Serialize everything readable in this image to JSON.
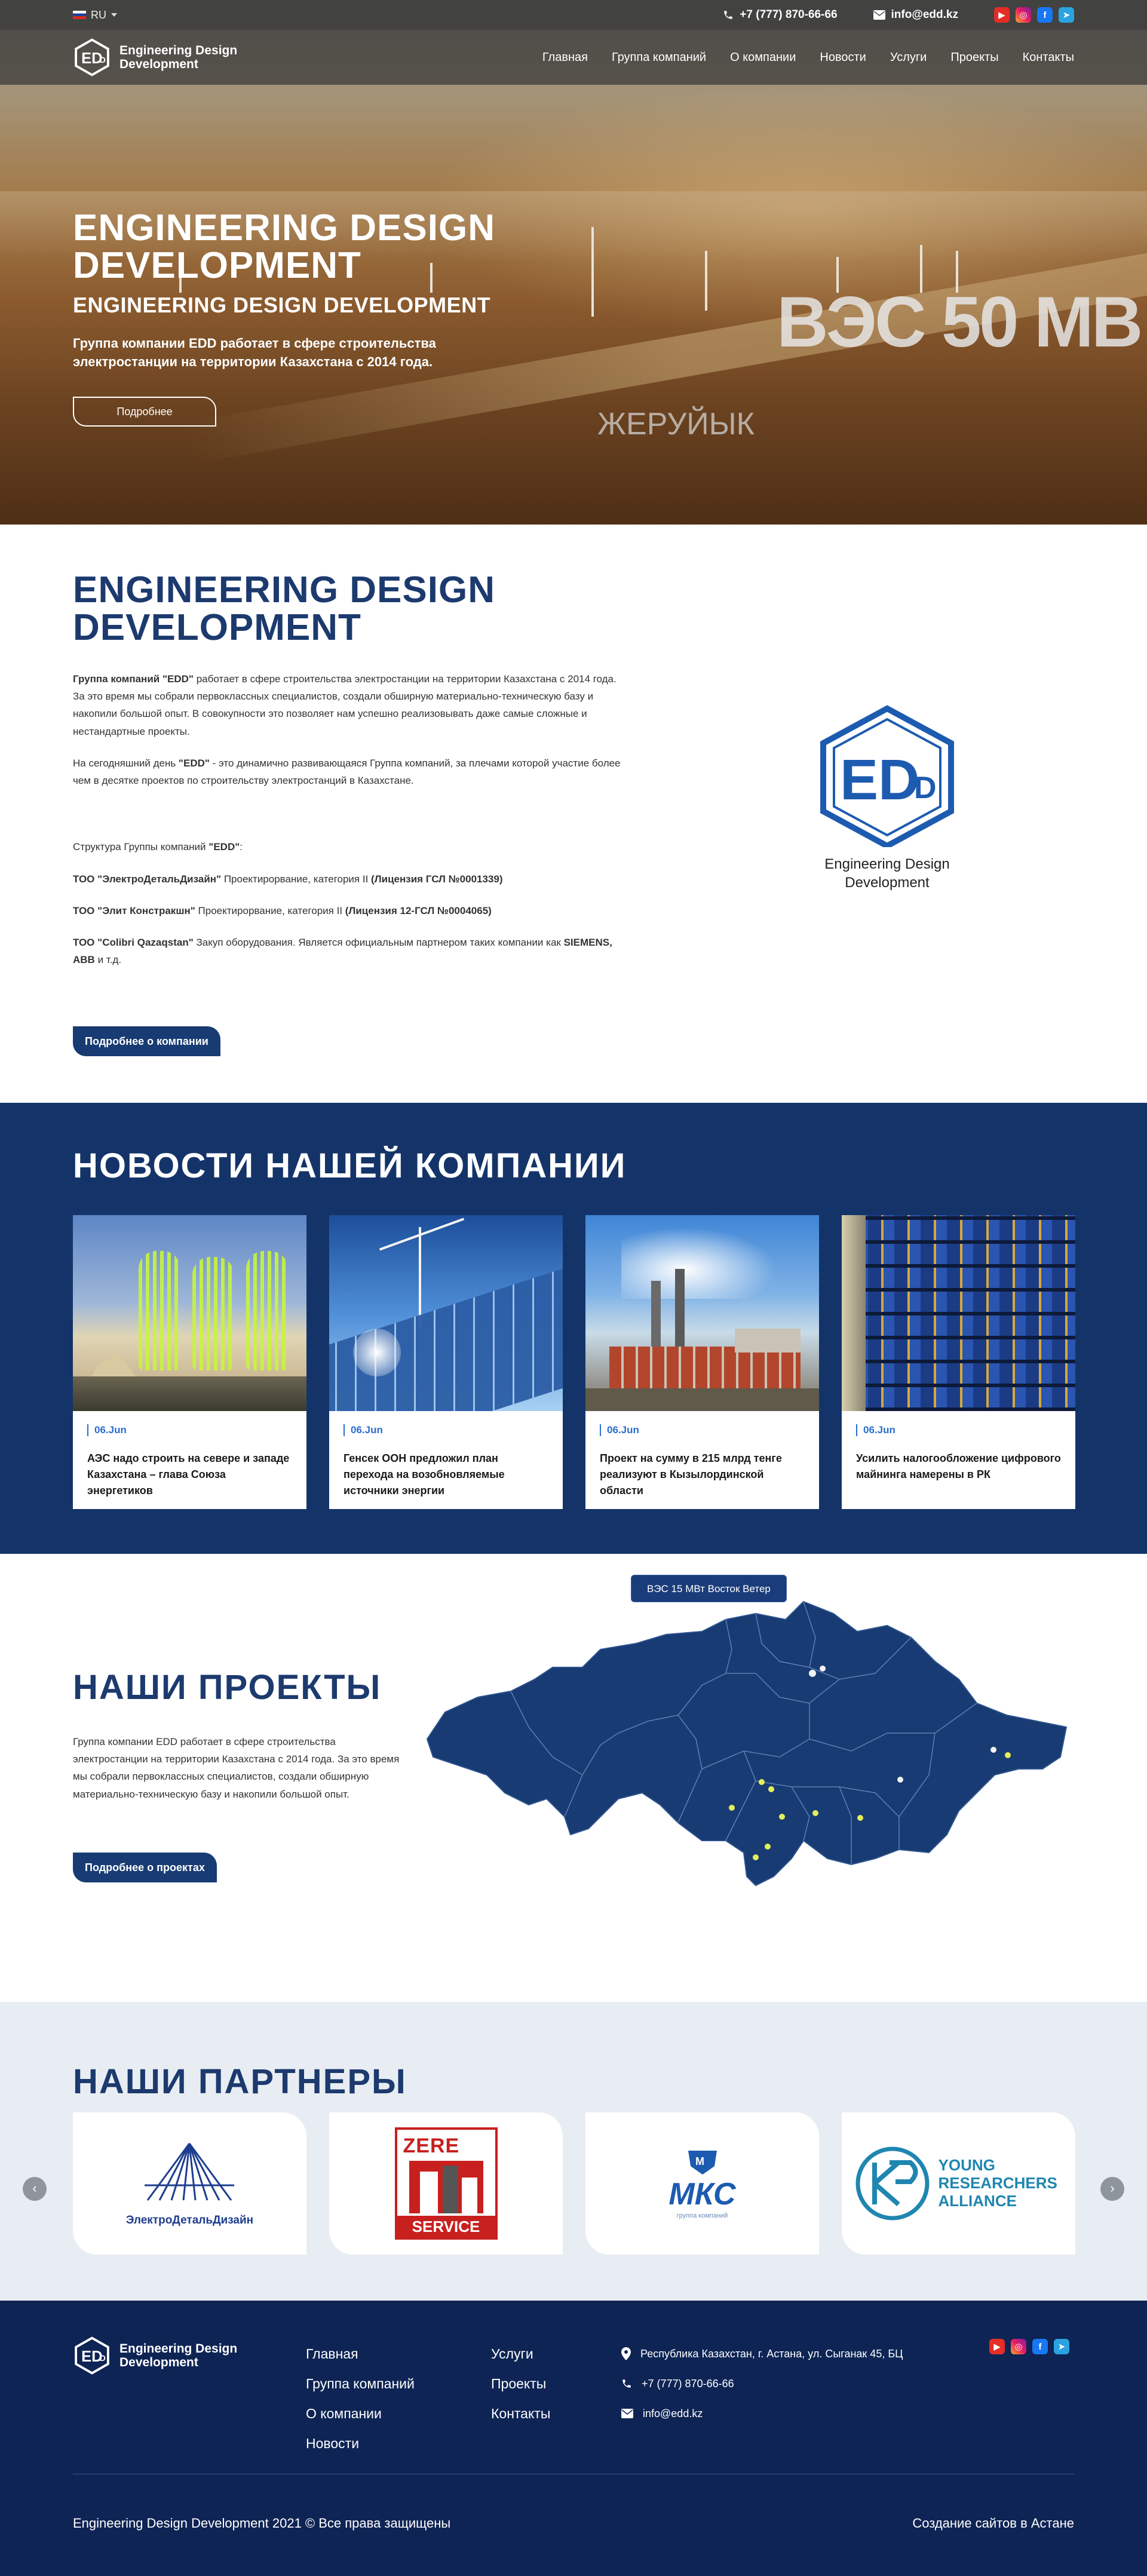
{
  "topbar": {
    "lang": "RU",
    "phone": "+7 (777) 870-66-66",
    "email": "info@edd.kz",
    "socials": [
      "youtube-icon",
      "instagram-icon",
      "facebook-icon",
      "telegram-icon"
    ]
  },
  "header": {
    "logo_line1": "Engineering Design",
    "logo_line2": "Development",
    "nav": [
      "Главная",
      "Группа компаний",
      "О компании",
      "Новости",
      "Услуги",
      "Проекты",
      "Контакты"
    ]
  },
  "hero": {
    "title": "ENGINEERING DESIGN DEVELOPMENT",
    "subtitle": "ENGINEERING DESIGN DEVELOPMENT",
    "text": "Группа компании EDD работает в сфере строительства электростанции на территории Казахстана с 2014 года.",
    "button": "Подробнее",
    "photo_overlay_big": "ВЭС 50 МВ",
    "photo_overlay_small": "ЖЕРУЙЫК"
  },
  "about": {
    "title": "ENGINEERING DESIGN DEVELOPMENT",
    "p1_bold": "Группа компаний \"EDD\"",
    "p1": " работает в сфере строительства электростанции на территории Казахстана с 2014 года. За это время мы собрали первоклассных специалистов, создали обширную материально-техническую базу и накопили большой опыт. В совокупности это позволяет нам успешно реализовывать даже самые сложные и нестандартные проекты.",
    "p2_a": "На сегодняшний день ",
    "p2_bold": "\"EDD\"",
    "p2_b": " - это динамично развивающаяся Группа компаний, за плечами которой участие более чем в десятке проектов по строительству электростанций в Казахстане.",
    "structure_a": "Структура Группы компаний ",
    "structure_bold": "\"EDD\"",
    "structure_b": ":",
    "c1_bold": "ТОО \"ЭлектроДетальДизайн\"",
    "c1": " Проектирорвание, категория II ",
    "c1_lic": "(Лицензия ГСЛ №0001339)",
    "c2_bold": "ТОО \"Элит Констракшн\"",
    "c2": " Проектирорвание, категория II ",
    "c2_lic": "(Лицензия 12-ГСЛ №0004065)",
    "c3_bold": "ТОО \"Colibri Qazaqstan\"",
    "c3": " Закуп оборудования. Является официальным партнером таких компании как ",
    "c3_bold2": "SIEMENS, ABB",
    "c3_end": " и т.д.",
    "button": "Подробнее о компании",
    "logo_line1": "Engineering Design",
    "logo_line2": "Development"
  },
  "news": {
    "title": "НОВОСТИ НАШЕЙ КОМПАНИИ",
    "items": [
      {
        "date": "06.Jun",
        "title": "АЭС надо строить на севере и западе Казахстана – глава Союза энергетиков"
      },
      {
        "date": "06.Jun",
        "title": "Генсек ООН предложил план перехода на возобновляемые источники энергии"
      },
      {
        "date": "06.Jun",
        "title": "Проект на сумму в 215 млрд тенге реализуют в Кызылординской области"
      },
      {
        "date": "06.Jun",
        "title": "Усилить налогообложение цифрового майнинга намерены в РК"
      }
    ]
  },
  "projects": {
    "title": "НАШИ ПРОЕКТЫ",
    "text": "Группа компании EDD работает в сфере строительства электростанции на территории Казахстана с 2014 года. За это время мы собрали первоклассных специалистов, создали обширную материально-техническую базу и накопили большой опыт.",
    "button": "Подробнее о проектах",
    "tooltip": "ВЭС 15 МВт Восток Ветер"
  },
  "partners": {
    "title": "НАШИ ПАРТНЕРЫ",
    "items": [
      {
        "name": "ЭлектроДетальДизайн"
      },
      {
        "name": "ZERE SERVICE"
      },
      {
        "name": "МКС",
        "sub": "группа компаний"
      },
      {
        "name": "YOUNG RESEARCHERS ALLIANCE"
      }
    ]
  },
  "footer": {
    "logo_line1": "Engineering Design",
    "logo_line2": "Development",
    "col1": [
      "Главная",
      "Группа компаний",
      "О компании",
      "Новости"
    ],
    "col2": [
      "Услуги",
      "Проекты",
      "Контакты"
    ],
    "address": "Республика Казахстан, г. Астана, ул. Сыганак 45, БЦ",
    "phone": "+7 (777) 870-66-66",
    "email": "info@edd.kz",
    "copyright": "Engineering Design Development 2021 © Все права защищены",
    "made": "Создание сайтов в Астане"
  }
}
